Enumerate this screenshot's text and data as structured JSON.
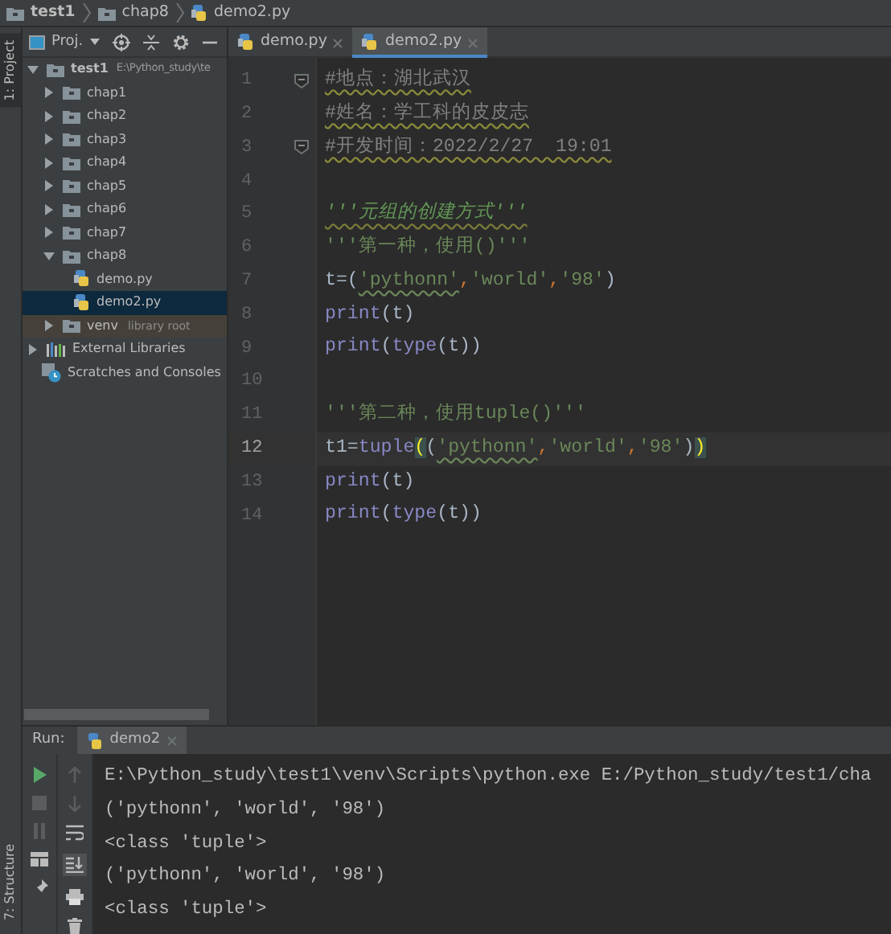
{
  "breadcrumb": [
    {
      "label": "test1",
      "kind": "folder"
    },
    {
      "label": "chap8",
      "kind": "folder"
    },
    {
      "label": "demo2.py",
      "kind": "python"
    }
  ],
  "tool_windows": {
    "top": [
      {
        "label": "1: Project",
        "selected": true
      }
    ],
    "bottom": [
      {
        "label": "7: Structure",
        "selected": false
      }
    ]
  },
  "project_panel": {
    "view": "Proj.",
    "tree": [
      {
        "label": "test1",
        "note": "E:\\Python_study\\te",
        "kind": "folder",
        "expanded": true,
        "selected": false,
        "children": [
          {
            "label": "chap1",
            "kind": "folder",
            "expanded": false,
            "selected": false
          },
          {
            "label": "chap2",
            "kind": "folder",
            "expanded": false,
            "selected": false
          },
          {
            "label": "chap3",
            "kind": "folder",
            "expanded": false,
            "selected": false
          },
          {
            "label": "chap4",
            "kind": "folder",
            "expanded": false,
            "selected": false
          },
          {
            "label": "chap5",
            "kind": "folder",
            "expanded": false,
            "selected": false
          },
          {
            "label": "chap6",
            "kind": "folder",
            "expanded": false,
            "selected": false
          },
          {
            "label": "chap7",
            "kind": "folder",
            "expanded": false,
            "selected": false
          },
          {
            "label": "chap8",
            "kind": "folder",
            "expanded": true,
            "selected": false,
            "children": [
              {
                "label": "demo.py",
                "kind": "python",
                "selected": false
              },
              {
                "label": "demo2.py",
                "kind": "python",
                "selected": true
              }
            ]
          },
          {
            "label": "venv",
            "note": "library root",
            "kind": "venv",
            "expanded": false,
            "selected": false
          }
        ]
      },
      {
        "label": "External Libraries",
        "kind": "library",
        "expanded": false,
        "selected": false
      },
      {
        "label": "Scratches and Consoles",
        "kind": "scratch",
        "selected": false
      }
    ]
  },
  "editor_tabs": [
    {
      "label": "demo.py",
      "selected": false
    },
    {
      "label": "demo2.py",
      "selected": true
    }
  ],
  "code_lines": [
    {
      "number": "1",
      "fold": true,
      "current": false,
      "tokens": [
        {
          "text": "#地点：湖北武汉",
          "kind": "comment"
        }
      ]
    },
    {
      "number": "2",
      "fold": false,
      "current": false,
      "tokens": [
        {
          "text": "#姓名：学工科的皮皮志",
          "kind": "comment"
        }
      ]
    },
    {
      "number": "3",
      "fold": true,
      "current": false,
      "tokens": [
        {
          "text": "#开发时间：2022/2/27  19:01",
          "kind": "comment"
        }
      ]
    },
    {
      "number": "4",
      "fold": false,
      "current": false
    },
    {
      "number": "5",
      "fold": false,
      "current": false,
      "tokens": [
        {
          "text": "'''元组的创建方式'''",
          "kind": "docstring"
        }
      ]
    },
    {
      "number": "6",
      "fold": false,
      "current": false,
      "tokens": [
        {
          "text": "'''第一种，使用()'''",
          "kind": "string"
        }
      ]
    },
    {
      "number": "7",
      "fold": false,
      "current": false,
      "tokens": [
        {
          "text": "t=(",
          "kind": "name"
        },
        {
          "text": "'pythonn'",
          "kind": "typo"
        },
        {
          "text": ",",
          "kind": "comma"
        },
        {
          "text": "'world'",
          "kind": "string"
        },
        {
          "text": ",",
          "kind": "comma"
        },
        {
          "text": "'98'",
          "kind": "string"
        },
        {
          "text": ")",
          "kind": "name"
        }
      ]
    },
    {
      "number": "8",
      "fold": false,
      "current": false,
      "tokens": [
        {
          "text": "print",
          "kind": "builtin"
        },
        {
          "text": "(t)",
          "kind": "name"
        }
      ]
    },
    {
      "number": "9",
      "fold": false,
      "current": false,
      "tokens": [
        {
          "text": "print",
          "kind": "builtin"
        },
        {
          "text": "(",
          "kind": "name"
        },
        {
          "text": "type",
          "kind": "builtin"
        },
        {
          "text": "(t))",
          "kind": "name"
        }
      ]
    },
    {
      "number": "10",
      "fold": false,
      "current": false
    },
    {
      "number": "11",
      "fold": false,
      "current": false,
      "tokens": [
        {
          "text": "'''第二种，使用tuple()'''",
          "kind": "string"
        }
      ]
    },
    {
      "number": "12",
      "fold": false,
      "current": true,
      "tokens": [
        {
          "text": "t1=",
          "kind": "name"
        },
        {
          "text": "tuple",
          "kind": "builtin"
        },
        {
          "text": "(",
          "kind": "match"
        },
        {
          "text": "(",
          "kind": "name"
        },
        {
          "text": "'pythonn'",
          "kind": "typo"
        },
        {
          "text": ",",
          "kind": "comma"
        },
        {
          "text": "'world'",
          "kind": "string"
        },
        {
          "text": ",",
          "kind": "comma"
        },
        {
          "text": "'98'",
          "kind": "string"
        },
        {
          "text": ")",
          "kind": "name"
        },
        {
          "text": ")",
          "kind": "match"
        }
      ]
    },
    {
      "number": "13",
      "fold": false,
      "current": false,
      "tokens": [
        {
          "text": "print",
          "kind": "builtin"
        },
        {
          "text": "(t)",
          "kind": "name"
        }
      ]
    },
    {
      "number": "14",
      "fold": false,
      "current": false,
      "tokens": [
        {
          "text": "print",
          "kind": "builtin"
        },
        {
          "text": "(",
          "kind": "name"
        },
        {
          "text": "type",
          "kind": "builtin"
        },
        {
          "text": "(t))",
          "kind": "name"
        }
      ]
    }
  ],
  "run_panel": {
    "label": "Run:",
    "tab": {
      "label": "demo2"
    },
    "console": [
      "E:\\Python_study\\test1\\venv\\Scripts\\python.exe E:/Python_study/test1/cha",
      "('pythonn', 'world', '98')",
      "<class 'tuple'>",
      "('pythonn', 'world', '98')",
      "<class 'tuple'>"
    ]
  }
}
